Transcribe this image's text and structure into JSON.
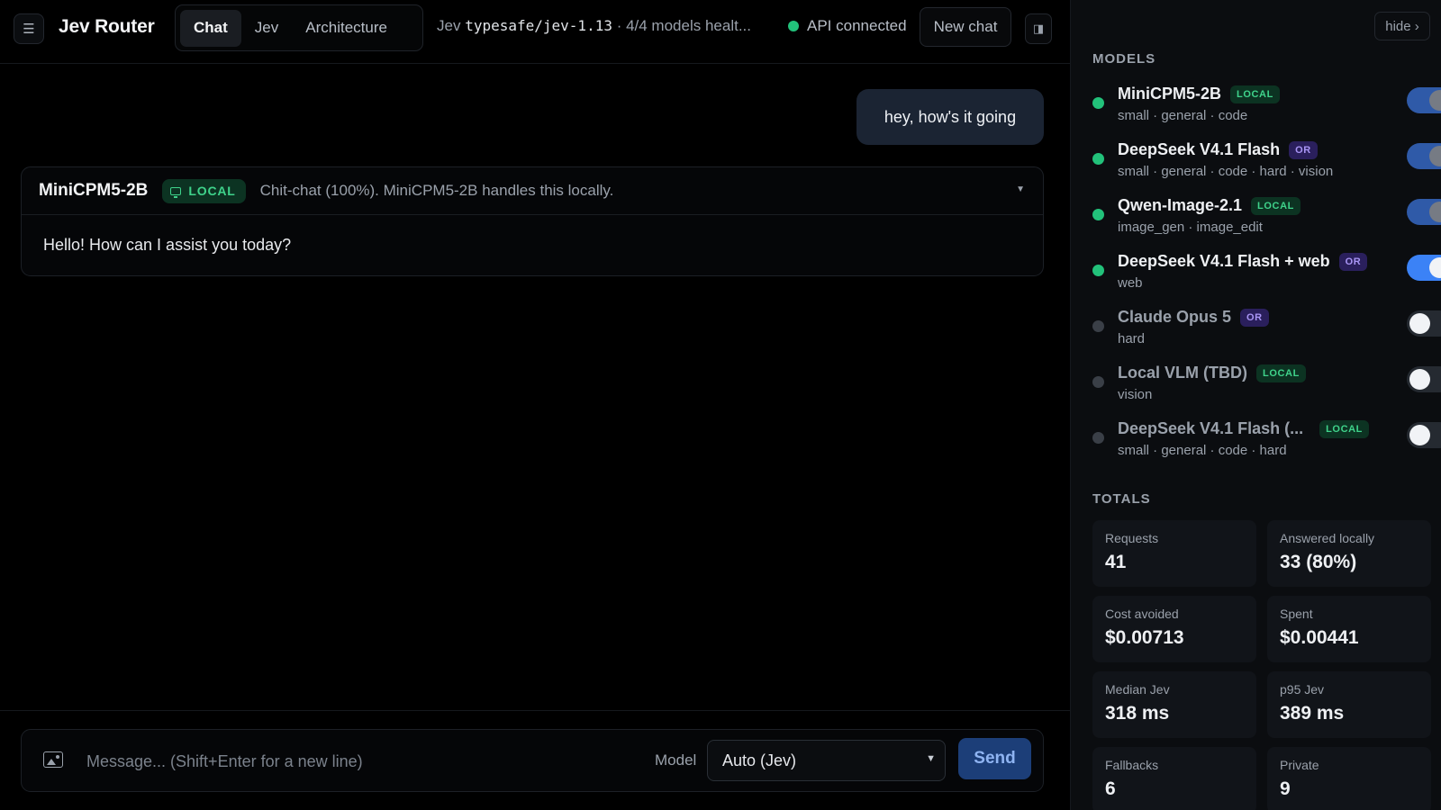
{
  "header": {
    "menu_icon": "menu-icon",
    "brand": "Jev Router",
    "tabs": [
      {
        "label": "Chat",
        "active": true
      },
      {
        "label": "Jev",
        "active": false
      },
      {
        "label": "Architecture",
        "active": false
      }
    ],
    "jev_prefix": "Jev",
    "jev_version": "typesafe/jev-1.13",
    "jev_health": " · 4/4 models healt...",
    "api_status": "API connected",
    "new_chat_label": "New chat",
    "panel_icon": "panel-toggle-icon"
  },
  "chat": {
    "user_message": "hey, how's it going",
    "reply": {
      "model": "MiniCPM5-2B",
      "badge": "LOCAL",
      "reason": "Chit-chat (100%). MiniCPM5-2B handles this locally.",
      "text": "Hello! How can I assist you today?"
    }
  },
  "composer": {
    "placeholder": "Message... (Shift+Enter for a new line)",
    "value": "",
    "model_label": "Model",
    "model_selected": "Auto (Jev)",
    "send_label": "Send"
  },
  "sidebar": {
    "hide_label": "hide ›",
    "models_title": "MODELS",
    "models": [
      {
        "name": "MiniCPM5-2B",
        "badge": "LOCAL",
        "tags": "small · general · code",
        "healthy": true,
        "enabled": true
      },
      {
        "name": "DeepSeek V4.1 Flash",
        "badge": "OR",
        "tags": "small · general · code · hard · vision",
        "healthy": true,
        "enabled": true
      },
      {
        "name": "Qwen-Image-2.1",
        "badge": "LOCAL",
        "tags": "image_gen · image_edit",
        "healthy": true,
        "enabled": true
      },
      {
        "name": "DeepSeek V4.1 Flash + web",
        "badge": "OR",
        "tags": "web",
        "healthy": true,
        "enabled": true
      },
      {
        "name": "Claude Opus 5",
        "badge": "OR",
        "tags": "hard",
        "healthy": false,
        "enabled": false
      },
      {
        "name": "Local VLM (TBD)",
        "badge": "LOCAL",
        "tags": "vision",
        "healthy": false,
        "enabled": false
      },
      {
        "name": "DeepSeek V4.1 Flash (...",
        "badge": "LOCAL",
        "tags": "small · general · code · hard",
        "healthy": false,
        "enabled": false
      }
    ],
    "totals_title": "TOTALS",
    "totals": [
      {
        "label": "Requests",
        "value": "41"
      },
      {
        "label": "Answered locally",
        "value": "33 (80%)"
      },
      {
        "label": "Cost avoided",
        "value": "$0.00713"
      },
      {
        "label": "Spent",
        "value": "$0.00441"
      },
      {
        "label": "Median Jev",
        "value": "318 ms"
      },
      {
        "label": "p95 Jev",
        "value": "389 ms"
      },
      {
        "label": "Fallbacks",
        "value": "6"
      },
      {
        "label": "Private",
        "value": "9"
      }
    ]
  },
  "colors": {
    "accent": "#3b82f6",
    "healthy": "#22c17a",
    "local_badge": "#3fd38b",
    "or_badge": "#a995f5"
  }
}
